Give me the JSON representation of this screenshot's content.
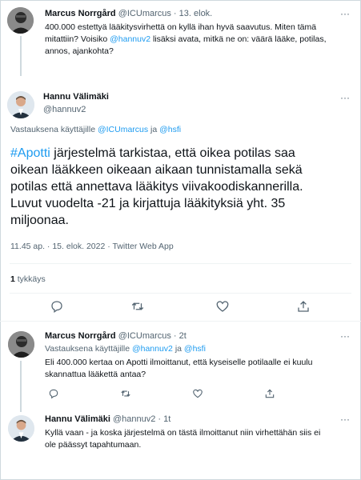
{
  "tweet1": {
    "author": "Marcus Norrgård",
    "handle": "@ICUmarcus",
    "date": "13. elok.",
    "line1": "400.000 estettyä lääkitysvirhettä on kyllä ihan hyvä saavutus. Miten tämä",
    "line2_pre": "mitattiin? Voisiko ",
    "mention": "@hannuv2",
    "line2_post": " lisäksi avata, mitkä ne on: väärä lääke, potilas,",
    "line3": "annos, ajankohta?"
  },
  "main": {
    "author": "Hannu Välimäki",
    "handle": "@hannuv2",
    "reply_prefix": "Vastauksena käyttäjille ",
    "reply_user1": "@ICUmarcus",
    "reply_and": " ja ",
    "reply_user2": "@hsfi",
    "hashtag": "#Apotti",
    "line1_rest": " järjestelmä tarkistaa, että oikea potilas saa",
    "line2": "oikean lääkkeen oikeaan aikaan tunnistamalla sekä",
    "line3": "potilas että annettava lääkitys viivakoodiskannerilla.",
    "line4": "Luvut vuodelta -21 ja kirjattuja lääkityksiä yht. 35",
    "line5": "miljoonaa.",
    "timestamp": "11.45 ap. · 15. elok. 2022 · Twitter Web App",
    "likes_count": "1",
    "likes_label": " tykkäys"
  },
  "reply1": {
    "author": "Marcus Norrgård",
    "handle": "@ICUmarcus",
    "date": "2t",
    "reply_prefix": "Vastauksena käyttäjille ",
    "reply_user1": "@hannuv2",
    "reply_and": " ja ",
    "reply_user2": "@hsfi",
    "line1": "Eli 400.000 kertaa on Apotti ilmoittanut, että kyseiselle potilaalle ei kuulu",
    "line2": "skannattua lääkettä antaa?"
  },
  "reply2": {
    "author": "Hannu Välimäki",
    "handle": "@hannuv2",
    "date": "1t",
    "line1": "Kyllä vaan - ja koska järjestelmä on tästä ilmoittanut niin virhettähän siis ei",
    "line2": "ole päässyt tapahtumaan."
  },
  "more_glyph": "···",
  "colors": {
    "link": "#1d9bf0",
    "secondary": "#536471",
    "border": "#cfd9de"
  }
}
